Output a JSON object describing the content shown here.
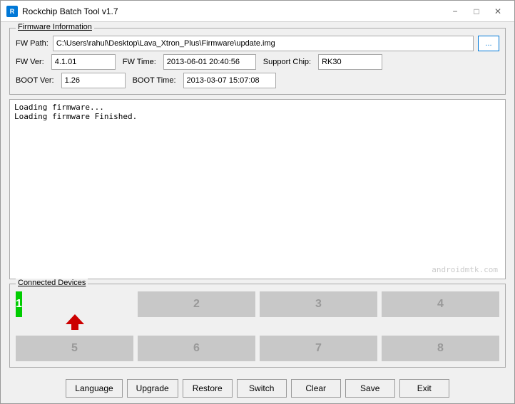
{
  "titleBar": {
    "title": "Rockchip Batch Tool v1.7",
    "iconText": "R",
    "minimizeLabel": "−",
    "maximizeLabel": "□",
    "closeLabel": "✕"
  },
  "firmware": {
    "sectionLabel": "Firmware Information",
    "fwPathLabel": "FW Path:",
    "fwPathValue": "C:\\Users\\rahul\\Desktop\\Lava_Xtron_Plus\\Firmware\\update.img",
    "browseLabel": "...",
    "fwVerLabel": "FW Ver:",
    "fwVerValue": "4.1.01",
    "fwTimeLabel": "FW Time:",
    "fwTimeValue": "2013-06-01 20:40:56",
    "supportChipLabel": "Support Chip:",
    "supportChipValue": "RK30",
    "bootVerLabel": "BOOT Ver:",
    "bootVerValue": "1.26",
    "bootTimeLabel": "BOOT Time:",
    "bootTimeValue": "2013-03-07 15:07:08"
  },
  "log": {
    "lines": [
      "Loading firmware...",
      "Loading firmware Finished."
    ],
    "watermark": "androidmtk.com"
  },
  "devices": {
    "sectionLabel": "Connected Devices",
    "buttons": [
      {
        "id": 1,
        "label": "1",
        "active": true
      },
      {
        "id": 2,
        "label": "2",
        "active": false
      },
      {
        "id": 3,
        "label": "3",
        "active": false
      },
      {
        "id": 4,
        "label": "4",
        "active": false
      },
      {
        "id": 5,
        "label": "5",
        "active": false
      },
      {
        "id": 6,
        "label": "6",
        "active": false
      },
      {
        "id": 7,
        "label": "7",
        "active": false
      },
      {
        "id": 8,
        "label": "8",
        "active": false
      }
    ]
  },
  "toolbar": {
    "buttons": [
      {
        "name": "language-button",
        "label": "Language"
      },
      {
        "name": "upgrade-button",
        "label": "Upgrade"
      },
      {
        "name": "restore-button",
        "label": "Restore"
      },
      {
        "name": "switch-button",
        "label": "Switch"
      },
      {
        "name": "clear-button",
        "label": "Clear"
      },
      {
        "name": "save-button",
        "label": "Save"
      },
      {
        "name": "exit-button",
        "label": "Exit"
      }
    ]
  }
}
